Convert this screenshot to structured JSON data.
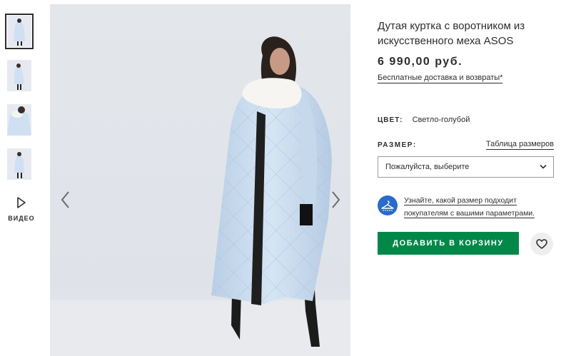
{
  "gallery": {
    "thumbnails": [
      "thumb-front",
      "thumb-side",
      "thumb-detail",
      "thumb-back"
    ],
    "video_label": "ВИДЕО"
  },
  "product": {
    "title": "Дутая куртка с воротником из искусственного меха ASOS",
    "price": "6 990,00 руб.",
    "delivery_link": "Бесплатные доставка и возвраты*"
  },
  "colour": {
    "label": "ЦВЕТ:",
    "value": "Светло-голубой"
  },
  "size": {
    "label": "РАЗМЕР:",
    "chart_link": "Таблица размеров",
    "select_value": "Пожалуйста, выберите"
  },
  "fit_assistant": {
    "text": "Узнайте, какой размер подходит покупателям с вашими параметрами.",
    "icon": "hanger-icon",
    "color": "#2a6ac9"
  },
  "actions": {
    "add_to_bag": "ДОБАВИТЬ В КОРЗИНУ",
    "add_color": "#018849",
    "save_icon": "heart-icon"
  }
}
